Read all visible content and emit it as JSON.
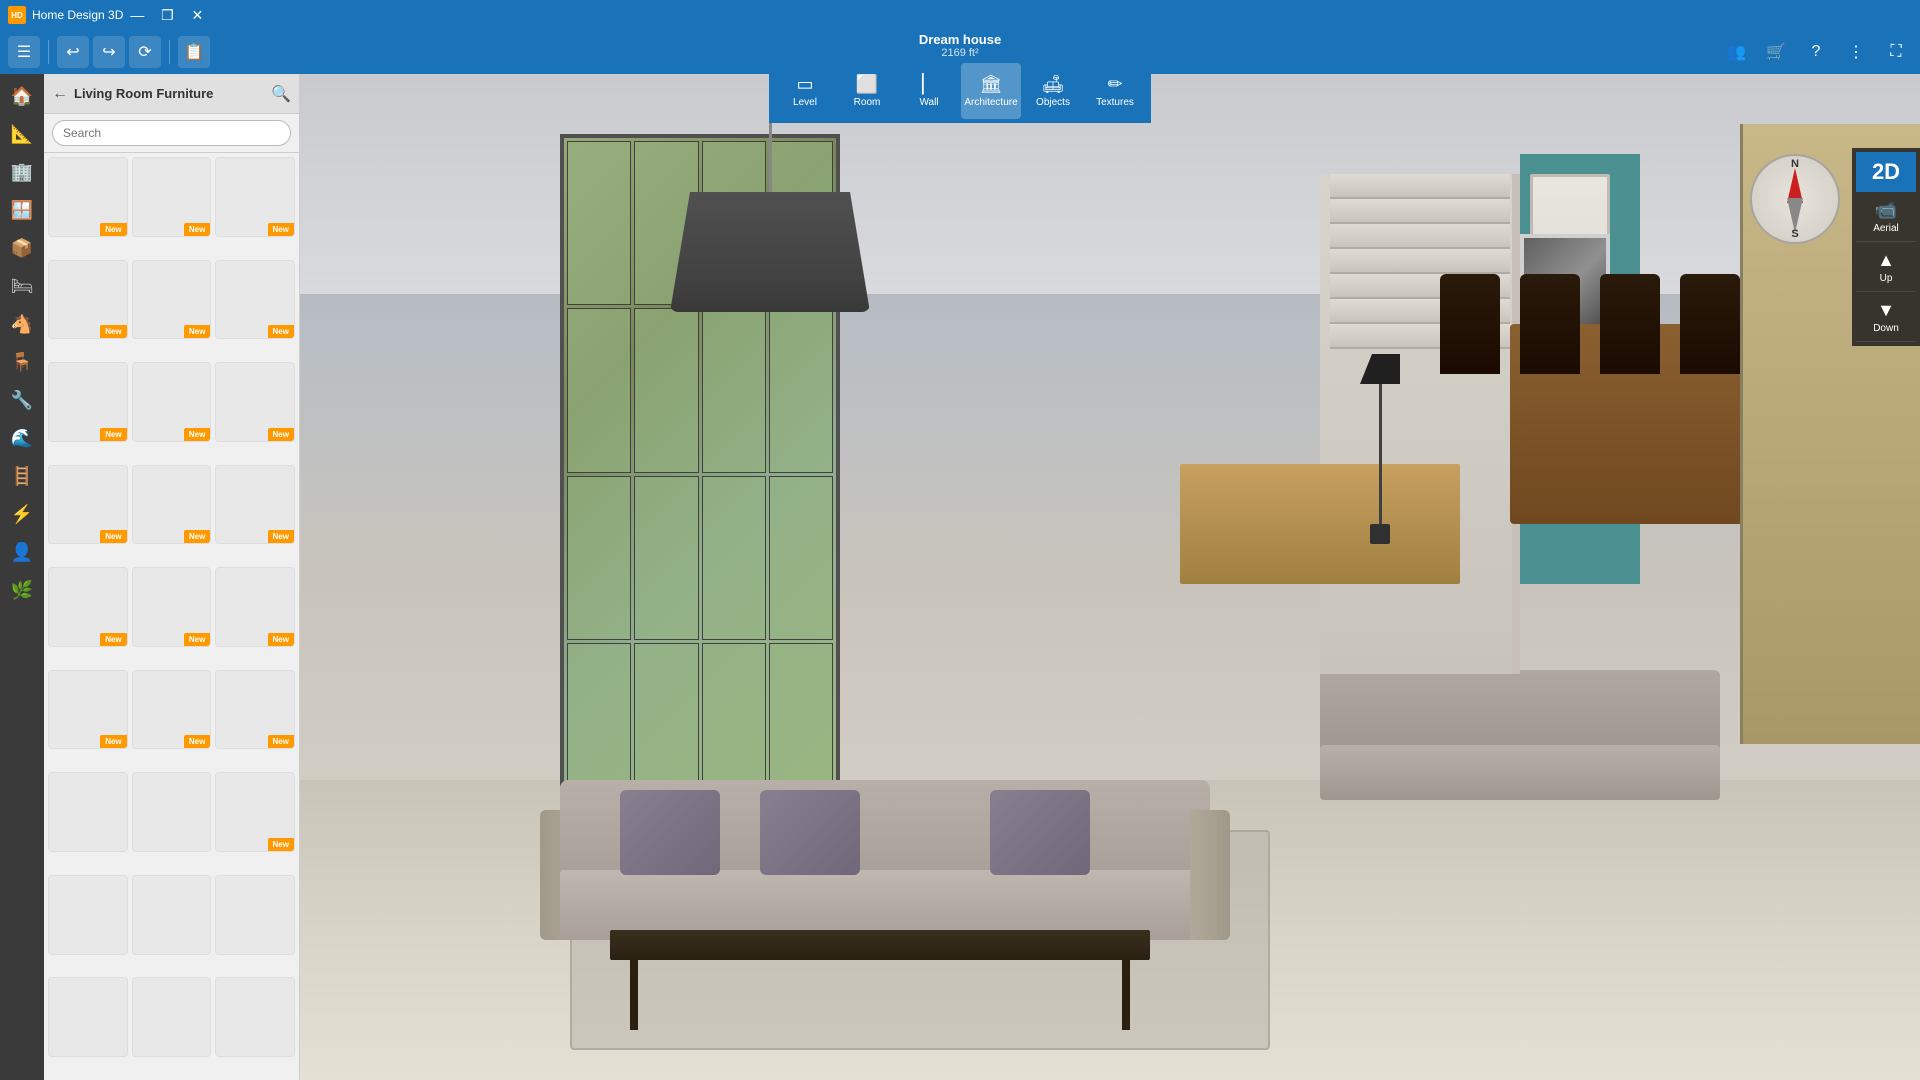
{
  "titleBar": {
    "appName": "Home Design 3D",
    "minimize": "—",
    "maximize": "❐",
    "close": "✕"
  },
  "toolbar": {
    "menu": "☰",
    "undo": "↩",
    "redo": "↪",
    "history": "⟳",
    "clipboard": "📋"
  },
  "project": {
    "name": "Dream house",
    "size": "2169 ft²"
  },
  "modes": [
    {
      "label": "Level",
      "icon": "▭",
      "active": false
    },
    {
      "label": "Room",
      "icon": "⬜",
      "active": false
    },
    {
      "label": "Wall",
      "icon": "▏",
      "active": false
    },
    {
      "label": "Architecture",
      "icon": "🏛",
      "active": true
    },
    {
      "label": "Objects",
      "icon": "🛋",
      "active": false
    },
    {
      "label": "Textures",
      "icon": "✏",
      "active": false
    }
  ],
  "rightToolbar": {
    "users": "👥",
    "cart": "🛒",
    "help": "?",
    "more": "⋮",
    "fullscreen": "⛶"
  },
  "panel": {
    "title": "Living Room Furniture",
    "searchPlaceholder": "Search",
    "backIcon": "←",
    "searchIcon": "🔍"
  },
  "sideIcons": [
    "🏠",
    "📐",
    "🏢",
    "🪟",
    "📦",
    "🛏",
    "🐴",
    "🪑",
    "🔧",
    "🌊",
    "🪜",
    "⚡",
    "👤",
    "🌿"
  ],
  "furnitureItems": [
    {
      "id": 1,
      "style": "furn-1",
      "new": true
    },
    {
      "id": 2,
      "style": "furn-2",
      "new": true
    },
    {
      "id": 3,
      "style": "furn-3",
      "new": true
    },
    {
      "id": 4,
      "style": "furn-4",
      "new": true
    },
    {
      "id": 5,
      "style": "furn-5",
      "new": true
    },
    {
      "id": 6,
      "style": "furn-6",
      "new": true
    },
    {
      "id": 7,
      "style": "furn-7",
      "new": true
    },
    {
      "id": 8,
      "style": "furn-8",
      "new": true
    },
    {
      "id": 9,
      "style": "furn-9",
      "new": true
    },
    {
      "id": 10,
      "style": "furn-10",
      "new": true
    },
    {
      "id": 11,
      "style": "furn-11",
      "new": true
    },
    {
      "id": 12,
      "style": "furn-12",
      "new": true
    },
    {
      "id": 13,
      "style": "furn-13",
      "new": true
    },
    {
      "id": 14,
      "style": "furn-14",
      "new": true
    },
    {
      "id": 15,
      "style": "furn-15",
      "new": true
    },
    {
      "id": 16,
      "style": "furn-16",
      "new": true
    },
    {
      "id": 17,
      "style": "furn-17",
      "new": true
    },
    {
      "id": 18,
      "style": "furn-18",
      "new": true
    },
    {
      "id": 19,
      "style": "furn-19",
      "new": false
    },
    {
      "id": 20,
      "style": "furn-20",
      "new": false
    },
    {
      "id": 21,
      "style": "furn-21",
      "new": true
    },
    {
      "id": 22,
      "style": "furn-22",
      "new": false
    },
    {
      "id": 23,
      "style": "furn-23",
      "new": false
    },
    {
      "id": 24,
      "style": "furn-24",
      "new": false
    },
    {
      "id": 25,
      "style": "furn-25",
      "new": false
    },
    {
      "id": 26,
      "style": "furn-26",
      "new": false
    },
    {
      "id": 27,
      "style": "furn-27",
      "new": false
    }
  ],
  "compass": {
    "n": "N",
    "s": "S"
  },
  "viewControls": {
    "aerial": "📹",
    "aerialLabel": "Aerial",
    "up": "▲",
    "upLabel": "Up",
    "down": "▼",
    "downLabel": "Down",
    "mode2d": "2D"
  },
  "newBadge": "New"
}
